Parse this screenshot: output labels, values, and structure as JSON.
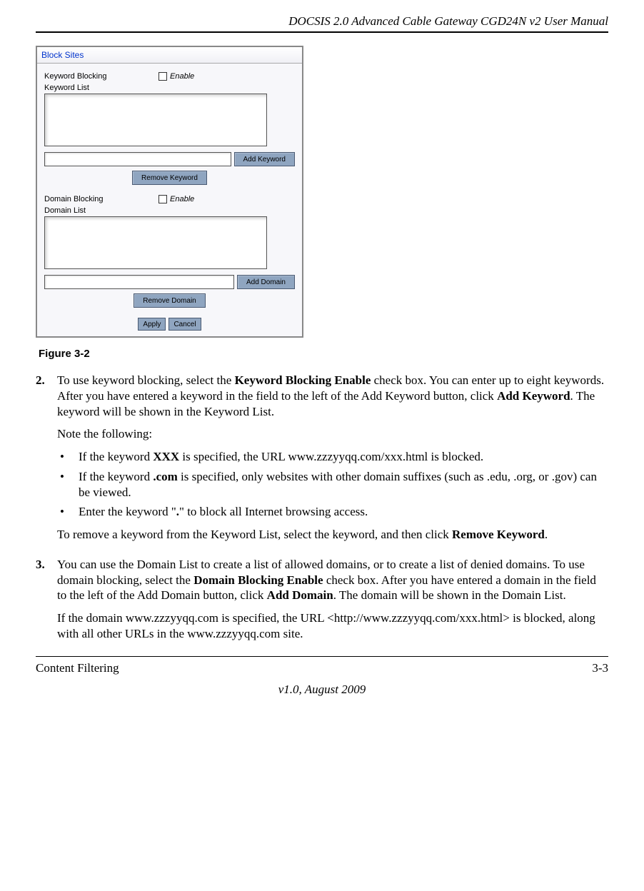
{
  "header": {
    "title": "DOCSIS 2.0 Advanced Cable Gateway CGD24N v2 User Manual"
  },
  "panel": {
    "title": "Block Sites",
    "keywordBlockingLabel": "Keyword Blocking",
    "enableLabel": "Enable",
    "keywordListLabel": "Keyword List",
    "addKeywordBtn": "Add Keyword",
    "removeKeywordBtn": "Remove Keyword",
    "domainBlockingLabel": "Domain Blocking",
    "domainListLabel": "Domain List",
    "addDomainBtn": "Add Domain",
    "removeDomainBtn": "Remove Domain",
    "applyBtn": "Apply",
    "cancelBtn": "Cancel"
  },
  "figureCaption": "Figure 3-2",
  "steps": {
    "s2": {
      "num": "2.",
      "p1a": "To use keyword blocking, select the ",
      "p1b": "Keyword Blocking Enable",
      "p1c": " check box. You can enter up to eight keywords. After you have entered a keyword in the field to the left of the Add Keyword button, click ",
      "p1d": "Add Keyword",
      "p1e": ". The keyword will be shown in the Keyword List.",
      "note": "Note the following:",
      "b1a": "If the keyword ",
      "b1b": "XXX",
      "b1c": " is specified, the URL www.zzzyyqq.com/xxx.html is blocked.",
      "b2a": "If the keyword ",
      "b2b": ".com",
      "b2c": " is specified, only websites with other domain suffixes (such as .edu, .org, or .gov) can be viewed.",
      "b3a": "Enter the keyword \"",
      "b3b": ".",
      "b3c": "\" to block all Internet browsing access.",
      "p2a": "To remove a keyword from the Keyword List, select the keyword, and then click ",
      "p2b": "Remove Keyword",
      "p2c": "."
    },
    "s3": {
      "num": "3.",
      "p1a": "You can use the Domain List to create a list of allowed domains, or to create a list of denied domains. To use domain blocking, select the ",
      "p1b": "Domain Blocking Enable",
      "p1c": " check box. After you have entered a domain in the field to the left of the Add Domain button, click ",
      "p1d": "Add Domain",
      "p1e": ". The domain will be shown in the Domain List.",
      "p2": "If the domain www.zzzyyqq.com is specified, the URL <http://www.zzzyyqq.com/xxx.html> is blocked, along with all other URLs in the www.zzzyyqq.com site."
    }
  },
  "footer": {
    "left": "Content Filtering",
    "right": "3-3",
    "center": "v1.0, August 2009"
  }
}
